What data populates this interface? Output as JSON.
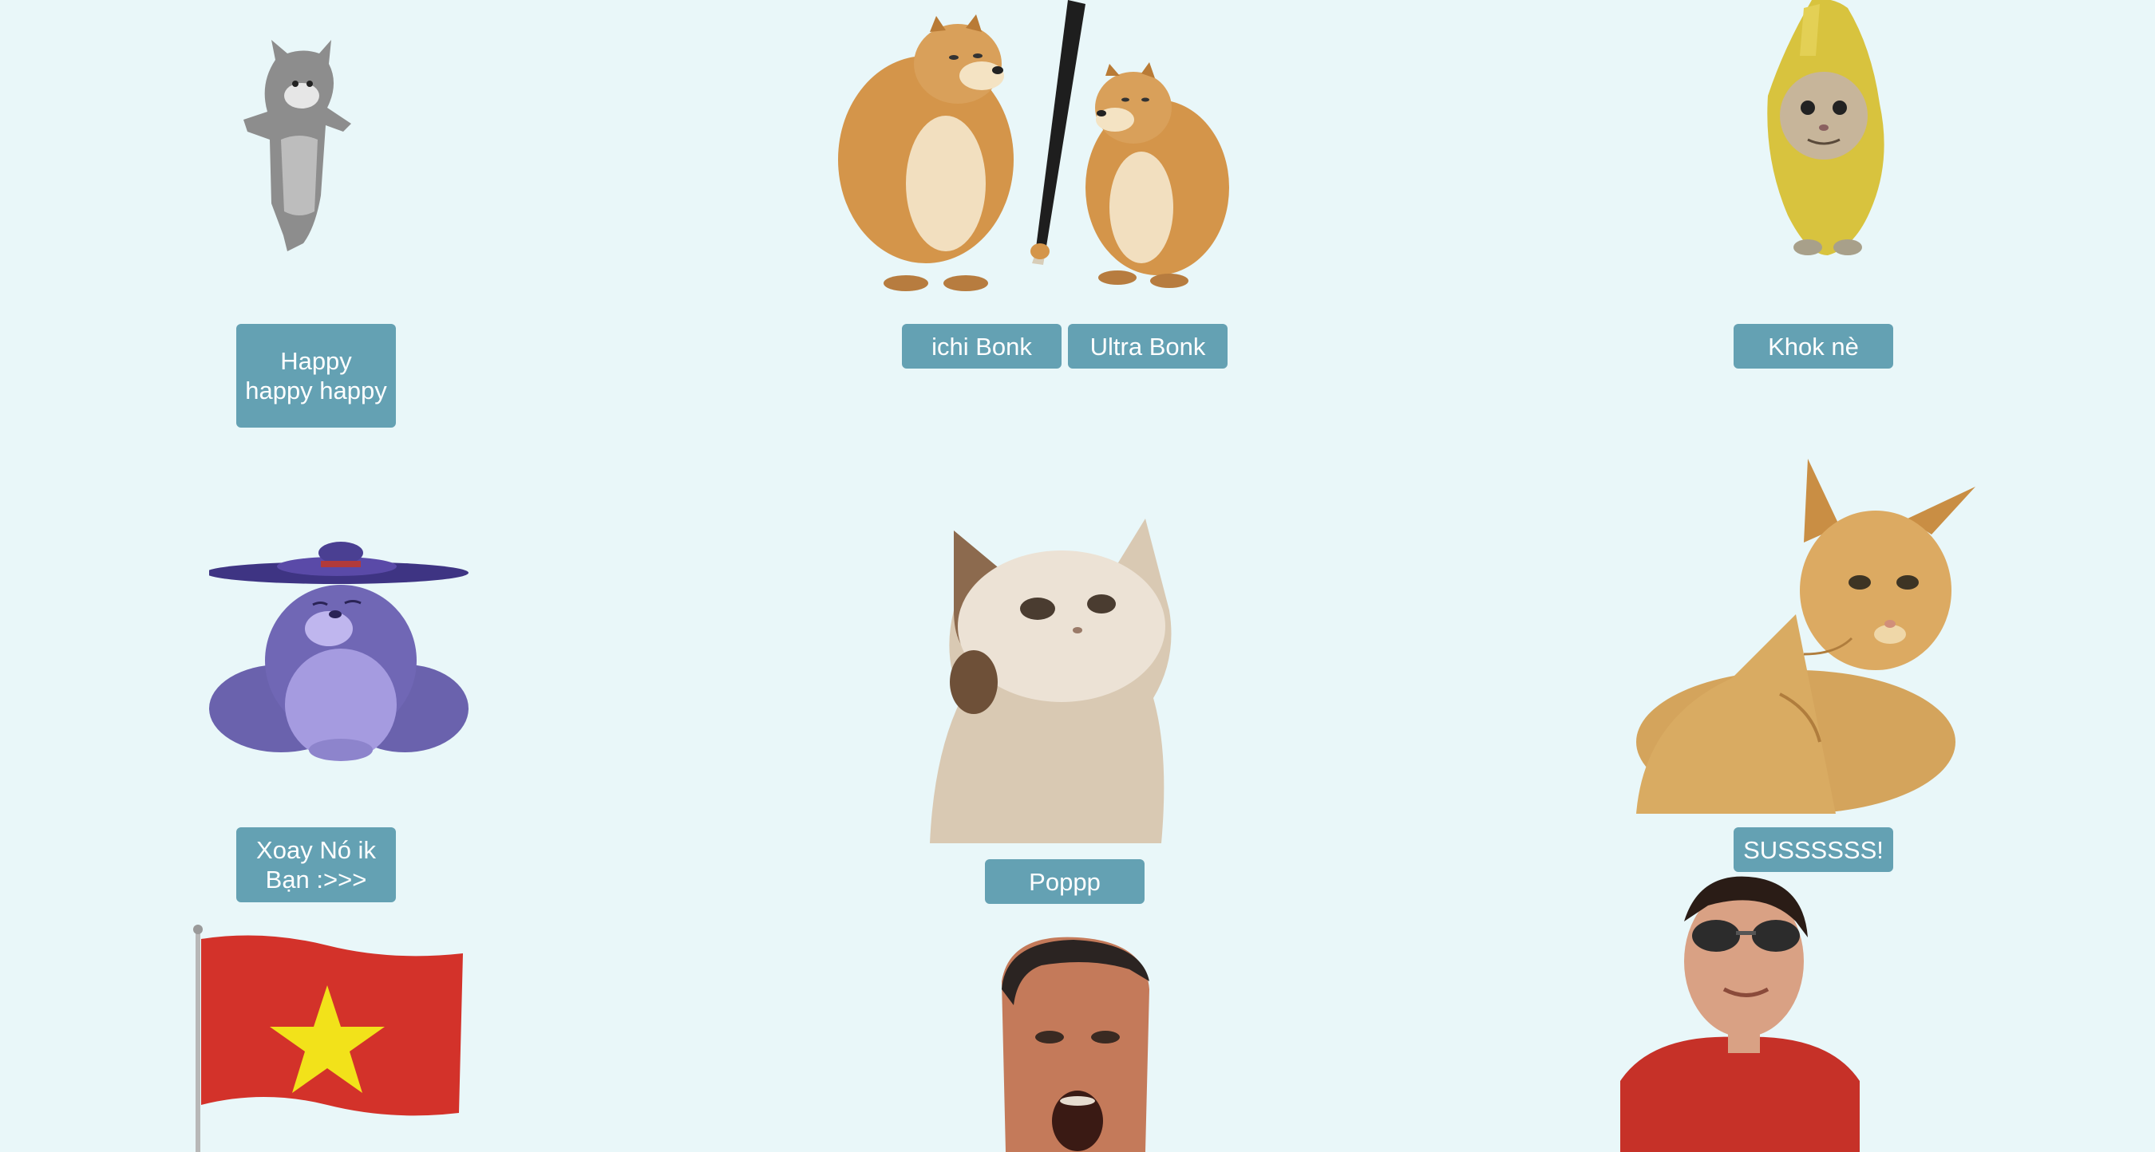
{
  "page": {
    "background": "#e9f7f9",
    "button_color": "#64a1b3",
    "button_text_color": "#ffffff"
  },
  "memes": [
    {
      "name": "dancing-cat",
      "description_icon": "cat-icon",
      "buttons": [
        "Happy happy happy"
      ]
    },
    {
      "name": "cheems-bonk",
      "description_icon": "dog-icon",
      "buttons": [
        "ichi Bonk",
        "Ultra Bonk"
      ]
    },
    {
      "name": "banana-cat",
      "description_icon": "cat-icon",
      "buttons": [
        "Khok nè"
      ]
    },
    {
      "name": "spinning-hat-creature",
      "description_icon": "creature-icon",
      "buttons": [
        "Xoay Nó ik Bạn :>>>"
      ]
    },
    {
      "name": "pop-cat",
      "description_icon": "cat-icon",
      "buttons": [
        "Poppp"
      ]
    },
    {
      "name": "orange-cat",
      "description_icon": "cat-icon",
      "buttons": [
        "SUSSSSSS!"
      ]
    },
    {
      "name": "vietnam-flag",
      "description_icon": "flag-icon",
      "buttons": []
    },
    {
      "name": "footballer-face",
      "description_icon": "person-icon",
      "buttons": []
    },
    {
      "name": "sunglasses-guy",
      "description_icon": "person-icon",
      "buttons": []
    }
  ],
  "buttons": {
    "happy": "Happy happy happy",
    "ichi_bonk": "ichi Bonk",
    "ultra_bonk": "Ultra Bonk",
    "khok_ne": "Khok nè",
    "xoay": "Xoay Nó ik Bạn :>>>",
    "poppp": "Poppp",
    "sus": "SUSSSSSS!"
  }
}
